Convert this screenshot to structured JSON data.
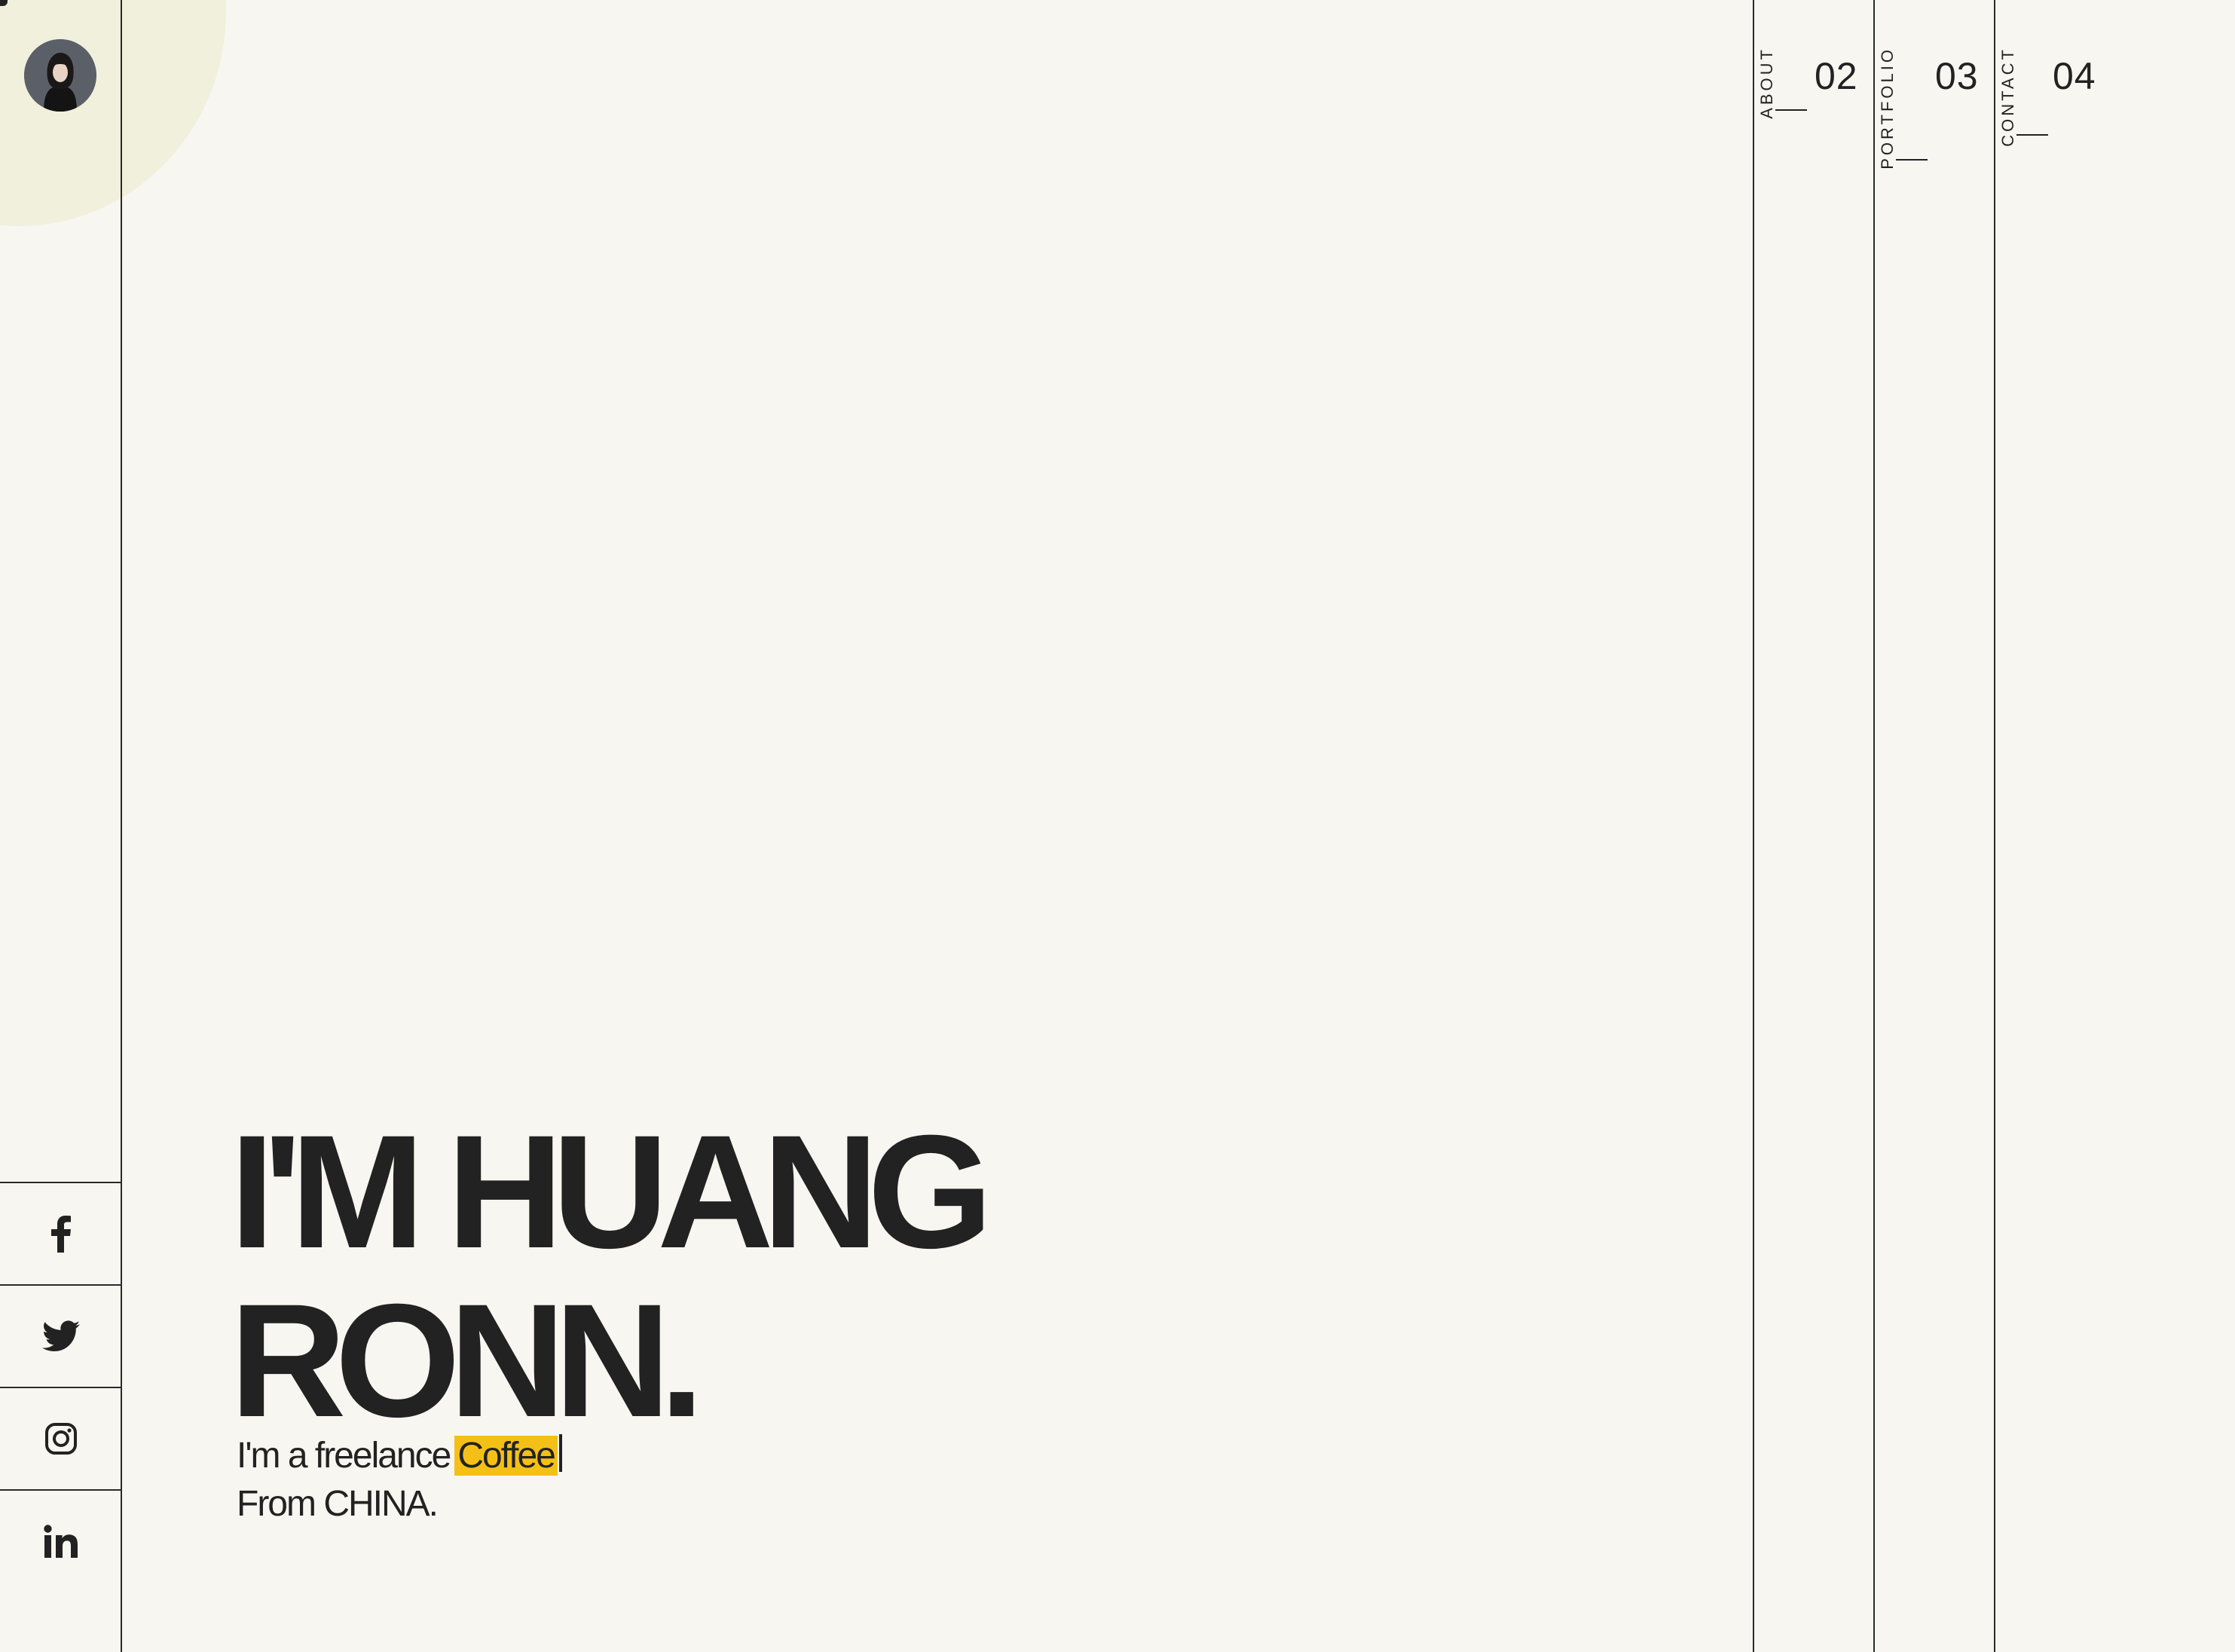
{
  "sidebar": {
    "avatar_alt": "profile avatar",
    "social": [
      {
        "name": "facebook",
        "icon": "facebook-icon"
      },
      {
        "name": "twitter",
        "icon": "twitter-icon"
      },
      {
        "name": "instagram",
        "icon": "instagram-icon"
      },
      {
        "name": "linkedin",
        "icon": "linkedin-icon"
      }
    ]
  },
  "nav": {
    "items": [
      {
        "label": "ABOUT",
        "number": "02"
      },
      {
        "label": "PORTFOLIO",
        "number": "03"
      },
      {
        "label": "CONTACT",
        "number": "04"
      }
    ]
  },
  "hero": {
    "title_line1": "I'M HUANG",
    "title_line2": "RONN.",
    "intro_prefix": "I'm a freelance",
    "typed_word": "Coffee",
    "origin": "From CHINA."
  },
  "colors": {
    "background": "#f7f6f1",
    "text": "#222222",
    "accent": "#f5c016",
    "corner_circle": "#f1f0dc"
  }
}
